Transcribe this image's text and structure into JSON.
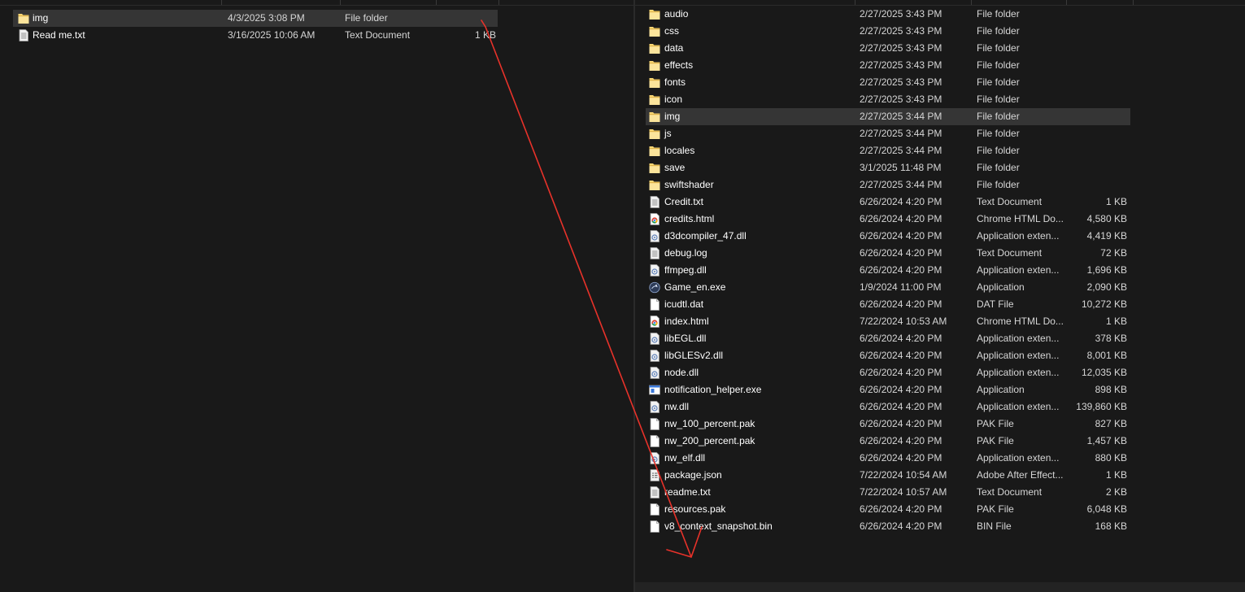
{
  "left_pane": {
    "files": [
      {
        "name": "img",
        "date": "4/3/2025 3:08 PM",
        "type": "File folder",
        "size": "",
        "icon": "folder-icon",
        "selected": true
      },
      {
        "name": "Read me.txt",
        "date": "3/16/2025 10:06 AM",
        "type": "Text Document",
        "size": "1 KB",
        "icon": "text-file-icon",
        "selected": false
      }
    ]
  },
  "right_pane": {
    "files": [
      {
        "name": "audio",
        "date": "2/27/2025 3:43 PM",
        "type": "File folder",
        "size": "",
        "icon": "folder-icon"
      },
      {
        "name": "css",
        "date": "2/27/2025 3:43 PM",
        "type": "File folder",
        "size": "",
        "icon": "folder-icon"
      },
      {
        "name": "data",
        "date": "2/27/2025 3:43 PM",
        "type": "File folder",
        "size": "",
        "icon": "folder-icon"
      },
      {
        "name": "effects",
        "date": "2/27/2025 3:43 PM",
        "type": "File folder",
        "size": "",
        "icon": "folder-icon"
      },
      {
        "name": "fonts",
        "date": "2/27/2025 3:43 PM",
        "type": "File folder",
        "size": "",
        "icon": "folder-icon"
      },
      {
        "name": "icon",
        "date": "2/27/2025 3:43 PM",
        "type": "File folder",
        "size": "",
        "icon": "folder-icon"
      },
      {
        "name": "img",
        "date": "2/27/2025 3:44 PM",
        "type": "File folder",
        "size": "",
        "icon": "folder-icon",
        "selected": true
      },
      {
        "name": "js",
        "date": "2/27/2025 3:44 PM",
        "type": "File folder",
        "size": "",
        "icon": "folder-icon"
      },
      {
        "name": "locales",
        "date": "2/27/2025 3:44 PM",
        "type": "File folder",
        "size": "",
        "icon": "folder-icon"
      },
      {
        "name": "save",
        "date": "3/1/2025 11:48 PM",
        "type": "File folder",
        "size": "",
        "icon": "folder-icon"
      },
      {
        "name": "swiftshader",
        "date": "2/27/2025 3:44 PM",
        "type": "File folder",
        "size": "",
        "icon": "folder-icon"
      },
      {
        "name": "Credit.txt",
        "date": "6/26/2024 4:20 PM",
        "type": "Text Document",
        "size": "1 KB",
        "icon": "text-file-icon"
      },
      {
        "name": "credits.html",
        "date": "6/26/2024 4:20 PM",
        "type": "Chrome HTML Do...",
        "size": "4,580 KB",
        "icon": "chrome-html-icon"
      },
      {
        "name": "d3dcompiler_47.dll",
        "date": "6/26/2024 4:20 PM",
        "type": "Application exten...",
        "size": "4,419 KB",
        "icon": "dll-icon"
      },
      {
        "name": "debug.log",
        "date": "6/26/2024 4:20 PM",
        "type": "Text Document",
        "size": "72 KB",
        "icon": "text-file-icon"
      },
      {
        "name": "ffmpeg.dll",
        "date": "6/26/2024 4:20 PM",
        "type": "Application exten...",
        "size": "1,696 KB",
        "icon": "dll-icon"
      },
      {
        "name": "Game_en.exe",
        "date": "1/9/2024 11:00 PM",
        "type": "Application",
        "size": "2,090 KB",
        "icon": "game-app-icon"
      },
      {
        "name": "icudtl.dat",
        "date": "6/26/2024 4:20 PM",
        "type": "DAT File",
        "size": "10,272 KB",
        "icon": "blank-file-icon"
      },
      {
        "name": "index.html",
        "date": "7/22/2024 10:53 AM",
        "type": "Chrome HTML Do...",
        "size": "1 KB",
        "icon": "chrome-html-icon"
      },
      {
        "name": "libEGL.dll",
        "date": "6/26/2024 4:20 PM",
        "type": "Application exten...",
        "size": "378 KB",
        "icon": "dll-icon"
      },
      {
        "name": "libGLESv2.dll",
        "date": "6/26/2024 4:20 PM",
        "type": "Application exten...",
        "size": "8,001 KB",
        "icon": "dll-icon"
      },
      {
        "name": "node.dll",
        "date": "6/26/2024 4:20 PM",
        "type": "Application exten...",
        "size": "12,035 KB",
        "icon": "dll-icon"
      },
      {
        "name": "notification_helper.exe",
        "date": "6/26/2024 4:20 PM",
        "type": "Application",
        "size": "898 KB",
        "icon": "exe-window-icon"
      },
      {
        "name": "nw.dll",
        "date": "6/26/2024 4:20 PM",
        "type": "Application exten...",
        "size": "139,860 KB",
        "icon": "dll-icon"
      },
      {
        "name": "nw_100_percent.pak",
        "date": "6/26/2024 4:20 PM",
        "type": "PAK File",
        "size": "827 KB",
        "icon": "blank-file-icon"
      },
      {
        "name": "nw_200_percent.pak",
        "date": "6/26/2024 4:20 PM",
        "type": "PAK File",
        "size": "1,457 KB",
        "icon": "blank-file-icon"
      },
      {
        "name": "nw_elf.dll",
        "date": "6/26/2024 4:20 PM",
        "type": "Application exten...",
        "size": "880 KB",
        "icon": "dll-icon"
      },
      {
        "name": "package.json",
        "date": "7/22/2024 10:54 AM",
        "type": "Adobe After Effect...",
        "size": "1 KB",
        "icon": "json-file-icon"
      },
      {
        "name": "readme.txt",
        "date": "7/22/2024 10:57 AM",
        "type": "Text Document",
        "size": "2 KB",
        "icon": "text-file-icon"
      },
      {
        "name": "resources.pak",
        "date": "6/26/2024 4:20 PM",
        "type": "PAK File",
        "size": "6,048 KB",
        "icon": "blank-file-icon"
      },
      {
        "name": "v8_context_snapshot.bin",
        "date": "6/26/2024 4:20 PM",
        "type": "BIN File",
        "size": "168 KB",
        "icon": "blank-file-icon"
      }
    ]
  },
  "colors": {
    "background": "#191919",
    "selected_row": "#353535",
    "folder": "#f8d775",
    "annotation_arrow": "#e8322a"
  }
}
